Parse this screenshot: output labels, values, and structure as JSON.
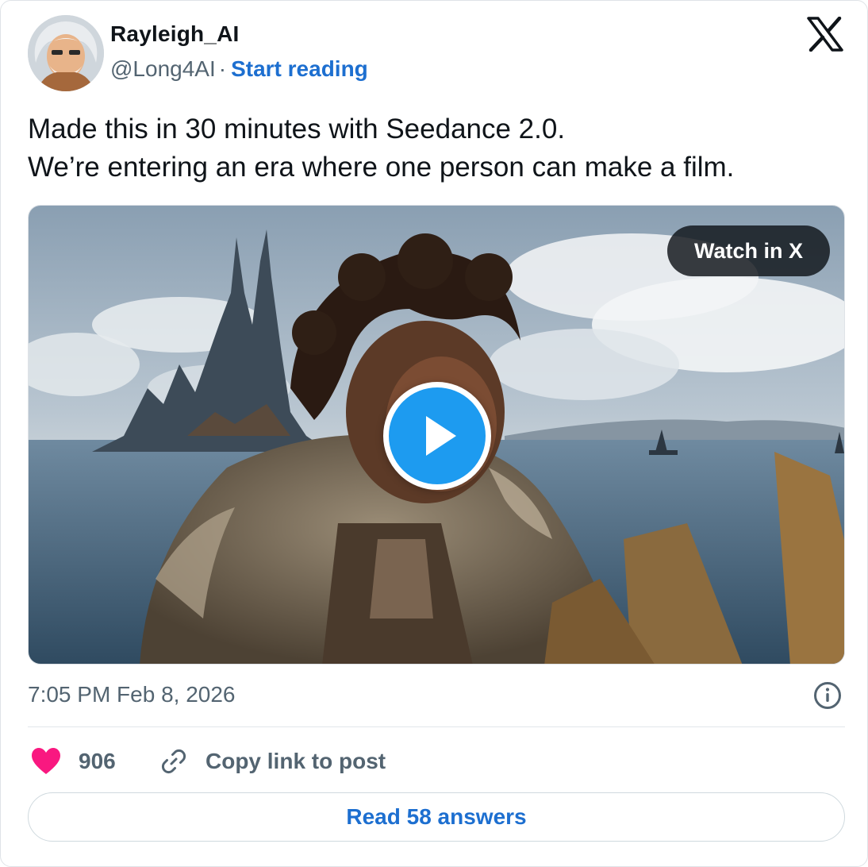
{
  "author": {
    "display_name": "Rayleigh_AI",
    "handle": "@Long4AI",
    "separator": "·",
    "start_reading_label": "Start reading"
  },
  "tweet": {
    "text_lines": [
      "Made this in 30 minutes with Seedance 2.0.",
      "We’re entering an era where one person can make a film."
    ],
    "timestamp": "7:05 PM Feb 8, 2026"
  },
  "media": {
    "watch_label": "Watch in X",
    "play_icon": "play-icon"
  },
  "actions": {
    "like_count": "906",
    "copy_link_label": "Copy link to post",
    "read_answers_label": "Read 58 answers"
  },
  "icons": {
    "logo": "x-logo-icon",
    "like": "heart-icon",
    "copy": "link-icon",
    "info": "info-icon"
  },
  "colors": {
    "link": "#1d6fd0",
    "play_button": "#1d9bf0",
    "heart": "#f91880",
    "muted_text": "#536471"
  }
}
